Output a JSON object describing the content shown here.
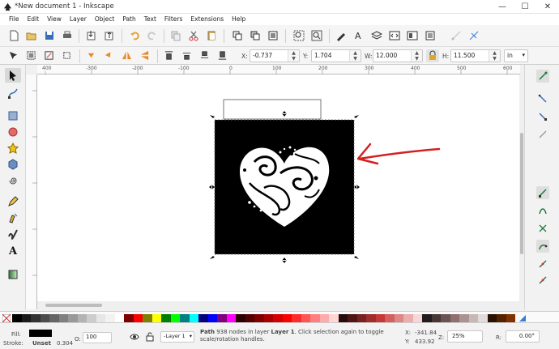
{
  "window": {
    "title": "*New document 1 - Inkscape",
    "minimize": "—",
    "maximize": "☐",
    "close": "✕"
  },
  "menu": [
    "File",
    "Edit",
    "View",
    "Layer",
    "Object",
    "Path",
    "Text",
    "Filters",
    "Extensions",
    "Help"
  ],
  "tool_controls": {
    "x_label": "X:",
    "x_value": "-0.737",
    "y_label": "Y:",
    "y_value": "1.704",
    "w_label": "W:",
    "w_value": "12.000",
    "h_label": "H:",
    "h_value": "11.500",
    "unit": "in"
  },
  "ruler_top": [
    "400",
    "-300",
    "-200",
    "-100",
    "0",
    "100",
    "200",
    "300",
    "400",
    "500",
    "600"
  ],
  "status": {
    "fill_label": "Fill:",
    "stroke_label": "Stroke:",
    "stroke_value": "Unset",
    "stroke_width": "0.304",
    "opacity_label": "O:",
    "opacity_value": "100",
    "layer_value": "-Layer 1",
    "message_strong": "Path",
    "message_part1": " 938 nodes in layer ",
    "message_layer": "Layer 1",
    "message_part2": ". Click selection again to toggle scale/rotation handles.",
    "x_label": "X:",
    "x_value": "-341.84",
    "y_label": "Y:",
    "y_value": "433.92",
    "zoom_label": "Z:",
    "zoom_value": "25%",
    "rotation_label": "R:",
    "rotation_value": "0.00°"
  },
  "colors": {
    "selection_fill": "#000000",
    "annotation_arrow": "#d42020",
    "accent": "#1d6ad4"
  },
  "icons": {
    "app": "inkscape-logo-icon",
    "arrow_annotation": "red-arrow-icon"
  }
}
